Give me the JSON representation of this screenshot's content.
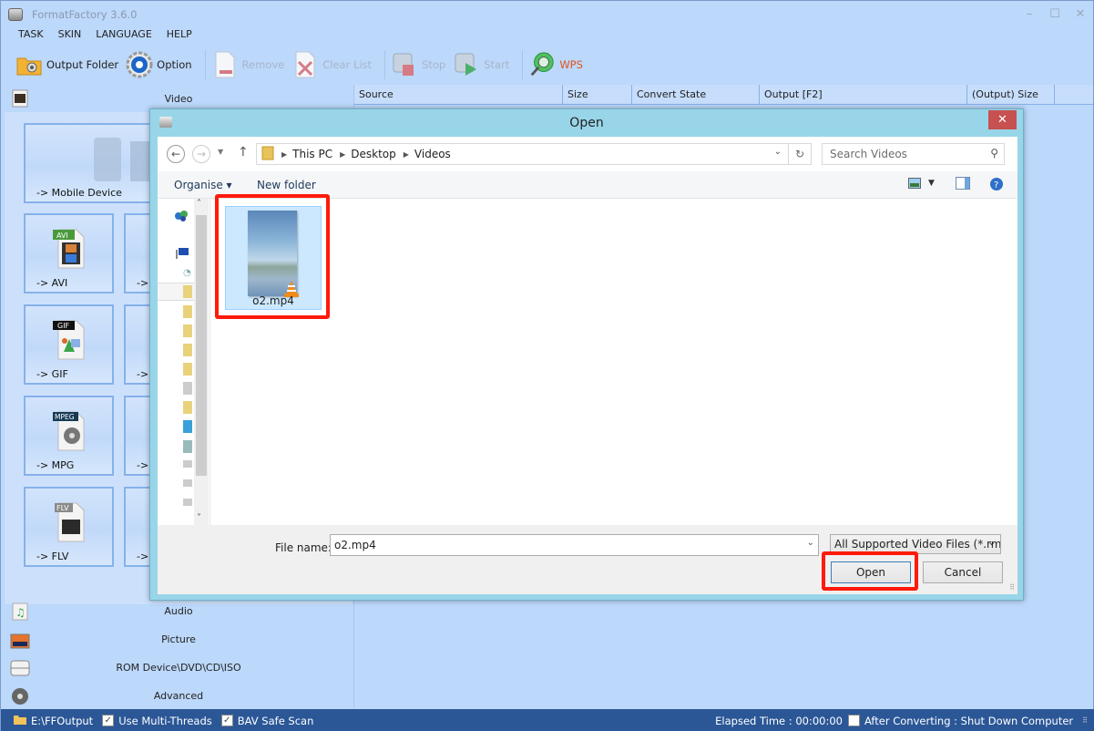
{
  "app": {
    "title": "FormatFactory 3.6.0",
    "window_controls": {
      "minimize": "–",
      "maximize": "☐",
      "close": "✕"
    }
  },
  "menu": [
    "TASK",
    "SKIN",
    "LANGUAGE",
    "HELP"
  ],
  "toolbar": {
    "output_folder": "Output Folder",
    "option": "Option",
    "remove": "Remove",
    "clear_list": "Clear List",
    "stop": "Stop",
    "start": "Start",
    "wps": "WPS"
  },
  "sidebar": {
    "video_label": "Video",
    "tiles": [
      {
        "label": "-> Mobile Device",
        "icon": "mobile-device-icon"
      },
      {
        "label": "-> AVI",
        "icon": "avi-file-icon",
        "badge": "AVI"
      },
      {
        "label": "->",
        "icon": ""
      },
      {
        "label": "-> GIF",
        "icon": "gif-file-icon",
        "badge": "GIF"
      },
      {
        "label": "->",
        "icon": ""
      },
      {
        "label": "-> MPG",
        "icon": "mpeg-file-icon",
        "badge": "MPEG"
      },
      {
        "label": "->",
        "icon": ""
      },
      {
        "label": "-> FLV",
        "icon": "flv-file-icon",
        "badge": "FLV"
      },
      {
        "label": "->",
        "icon": ""
      }
    ],
    "categories": [
      {
        "label": "Audio",
        "icon": "audio-icon"
      },
      {
        "label": "Picture",
        "icon": "picture-icon"
      },
      {
        "label": "ROM Device\\DVD\\CD\\ISO",
        "icon": "rom-drive-icon"
      },
      {
        "label": "Advanced",
        "icon": "advanced-reel-icon"
      }
    ]
  },
  "list": {
    "columns": [
      "Source",
      "Size",
      "Convert State",
      "Output [F2]",
      "(Output) Size"
    ]
  },
  "statusbar": {
    "output_path": "E:\\FFOutput",
    "multi_threads": {
      "label": "Use Multi-Threads",
      "checked": true
    },
    "bav_safe_scan": {
      "label": "BAV Safe Scan",
      "checked": true
    },
    "elapsed": "Elapsed Time : 00:00:00",
    "after_converting": {
      "label": "After Converting : Shut Down Computer",
      "checked": false
    }
  },
  "dialog": {
    "title": "Open",
    "close": "✕",
    "breadcrumb": [
      "This PC",
      "Desktop",
      "Videos"
    ],
    "search_placeholder": "Search Videos",
    "organise": "Organise ▾",
    "new_folder": "New folder",
    "files": [
      {
        "name": "o2.mp4",
        "selected": true
      }
    ],
    "file_name_label": "File name:",
    "file_name_value": "o2.mp4",
    "file_type": "All Supported Video Files (*.rm;",
    "open_button": "Open",
    "cancel_button": "Cancel"
  }
}
